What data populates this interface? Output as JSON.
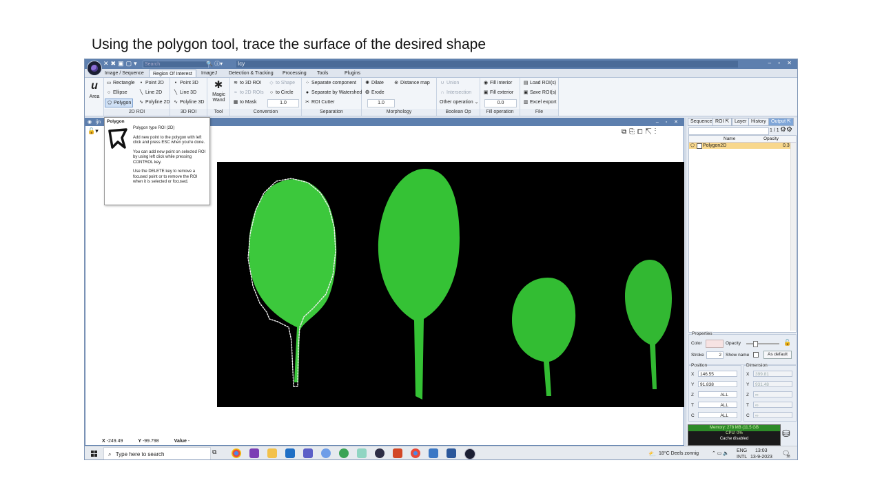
{
  "caption": "Using the polygon tool, trace the surface of the desired shape",
  "titlebar": {
    "search_placeholder": "Search",
    "app_title": "Icy"
  },
  "menu_tabs": [
    {
      "label": "Image / Sequence",
      "active": false
    },
    {
      "label": "Region Of Interest",
      "active": true
    },
    {
      "label": "ImageJ",
      "active": false
    },
    {
      "label": "Detection & Tracking",
      "active": false
    },
    {
      "label": "Processing",
      "active": false
    },
    {
      "label": "Tools",
      "active": false
    },
    {
      "label": "Plugins",
      "active": false
    }
  ],
  "ribbon": {
    "area": {
      "label": "Area"
    },
    "roi2d": {
      "label": "2D ROI",
      "rectangle": "Rectangle",
      "ellipse": "Ellipse",
      "polygon": "Polygon",
      "point": "Point 2D",
      "line": "Line 2D",
      "polyline": "Polyline 2D"
    },
    "roi3d": {
      "label": "3D ROI",
      "point": "Point 3D",
      "line": "Line 3D",
      "polyline": "Polyline 3D"
    },
    "tool": {
      "label": "Tool",
      "magic_wand": "Magic Wand"
    },
    "conversion": {
      "label": "Conversion",
      "to3d": "to 3D ROI",
      "to2d": "to 2D ROIs",
      "tomask": "to Mask",
      "toshape": "to Shape",
      "tocircle": "to Circle",
      "value": "1.0"
    },
    "separation": {
      "label": "Separation",
      "component": "Separate component",
      "watershed": "Separate by Watershed",
      "cutter": "ROI Cutter",
      "value": "1.0"
    },
    "morphology": {
      "label": "Morphology",
      "dilate": "Dilate",
      "erode": "Erode",
      "distance": "Distance map",
      "value": "1.0"
    },
    "boolean": {
      "label": "Boolean Op",
      "union": "Union",
      "intersection": "Intersection",
      "other": "Other operation"
    },
    "fill": {
      "label": "Fill operation",
      "interior": "Fill interior",
      "exterior": "Fill exterior",
      "value": "0.0"
    },
    "file": {
      "label": "File",
      "load": "Load ROI(s)",
      "save": "Save ROI(s)",
      "excel": "Excel export"
    }
  },
  "viewer": {
    "title": "ijn",
    "status_x_label": "X",
    "status_x": "-249.49",
    "status_y_label": "Y",
    "status_y": "-99.798",
    "status_value_label": "Value",
    "status_value": "-"
  },
  "tooltip": {
    "title": "Polygon",
    "heading": "Polygon type ROI (2D)",
    "p1": "Add new point to the polygon with left click and press ESC when you're done.",
    "p2": "You can add new point on selected ROI by using left click while pressing CONTROL key.",
    "p3": "Use the DELETE key to remove a focused point or to remove the ROI when it is selected or focused."
  },
  "right_panel": {
    "tabs": [
      {
        "label": "Sequence",
        "active": false
      },
      {
        "label": "ROI",
        "active": false
      },
      {
        "label": "Layer",
        "active": false
      },
      {
        "label": "History",
        "active": false
      },
      {
        "label": "Output",
        "active": true
      }
    ],
    "count": "1 / 1",
    "col_name": "Name",
    "col_opacity": "Opacity",
    "roi_name": "Polygon2D",
    "roi_opacity": "0.3",
    "properties_label": "Properties",
    "color_label": "Color",
    "opacity_label": "Opacity",
    "stroke_label": "Stroke",
    "stroke_value": "2",
    "show_name_label": "Show name",
    "as_default": "As default",
    "position_label": "Position",
    "dimension_label": "Dimension",
    "pos_x": "146.55",
    "pos_y": "91.838",
    "pos_z": "ALL",
    "pos_t": "ALL",
    "pos_c": "ALL",
    "dim_x": "399.81",
    "dim_y": "931.48",
    "dim_z": "∞",
    "dim_t": "∞",
    "dim_c": "∞",
    "memory_line1": "Memory: 278 MB (11.5 GB",
    "memory_line2": "CPU: 0%",
    "memory_line3": "Cache disabled"
  },
  "taskbar": {
    "search_placeholder": "Type here to search",
    "weather": "18°C  Deels zonnig",
    "lang1": "ENG",
    "lang2": "INTL",
    "time": "13:03",
    "date": "13-9-2023",
    "notif": "18"
  },
  "colors": {
    "accent": "#5d7fae",
    "roi_outline": "#ffffff",
    "leaf": "#2ec22e",
    "roi_row": "#f8d78c"
  }
}
